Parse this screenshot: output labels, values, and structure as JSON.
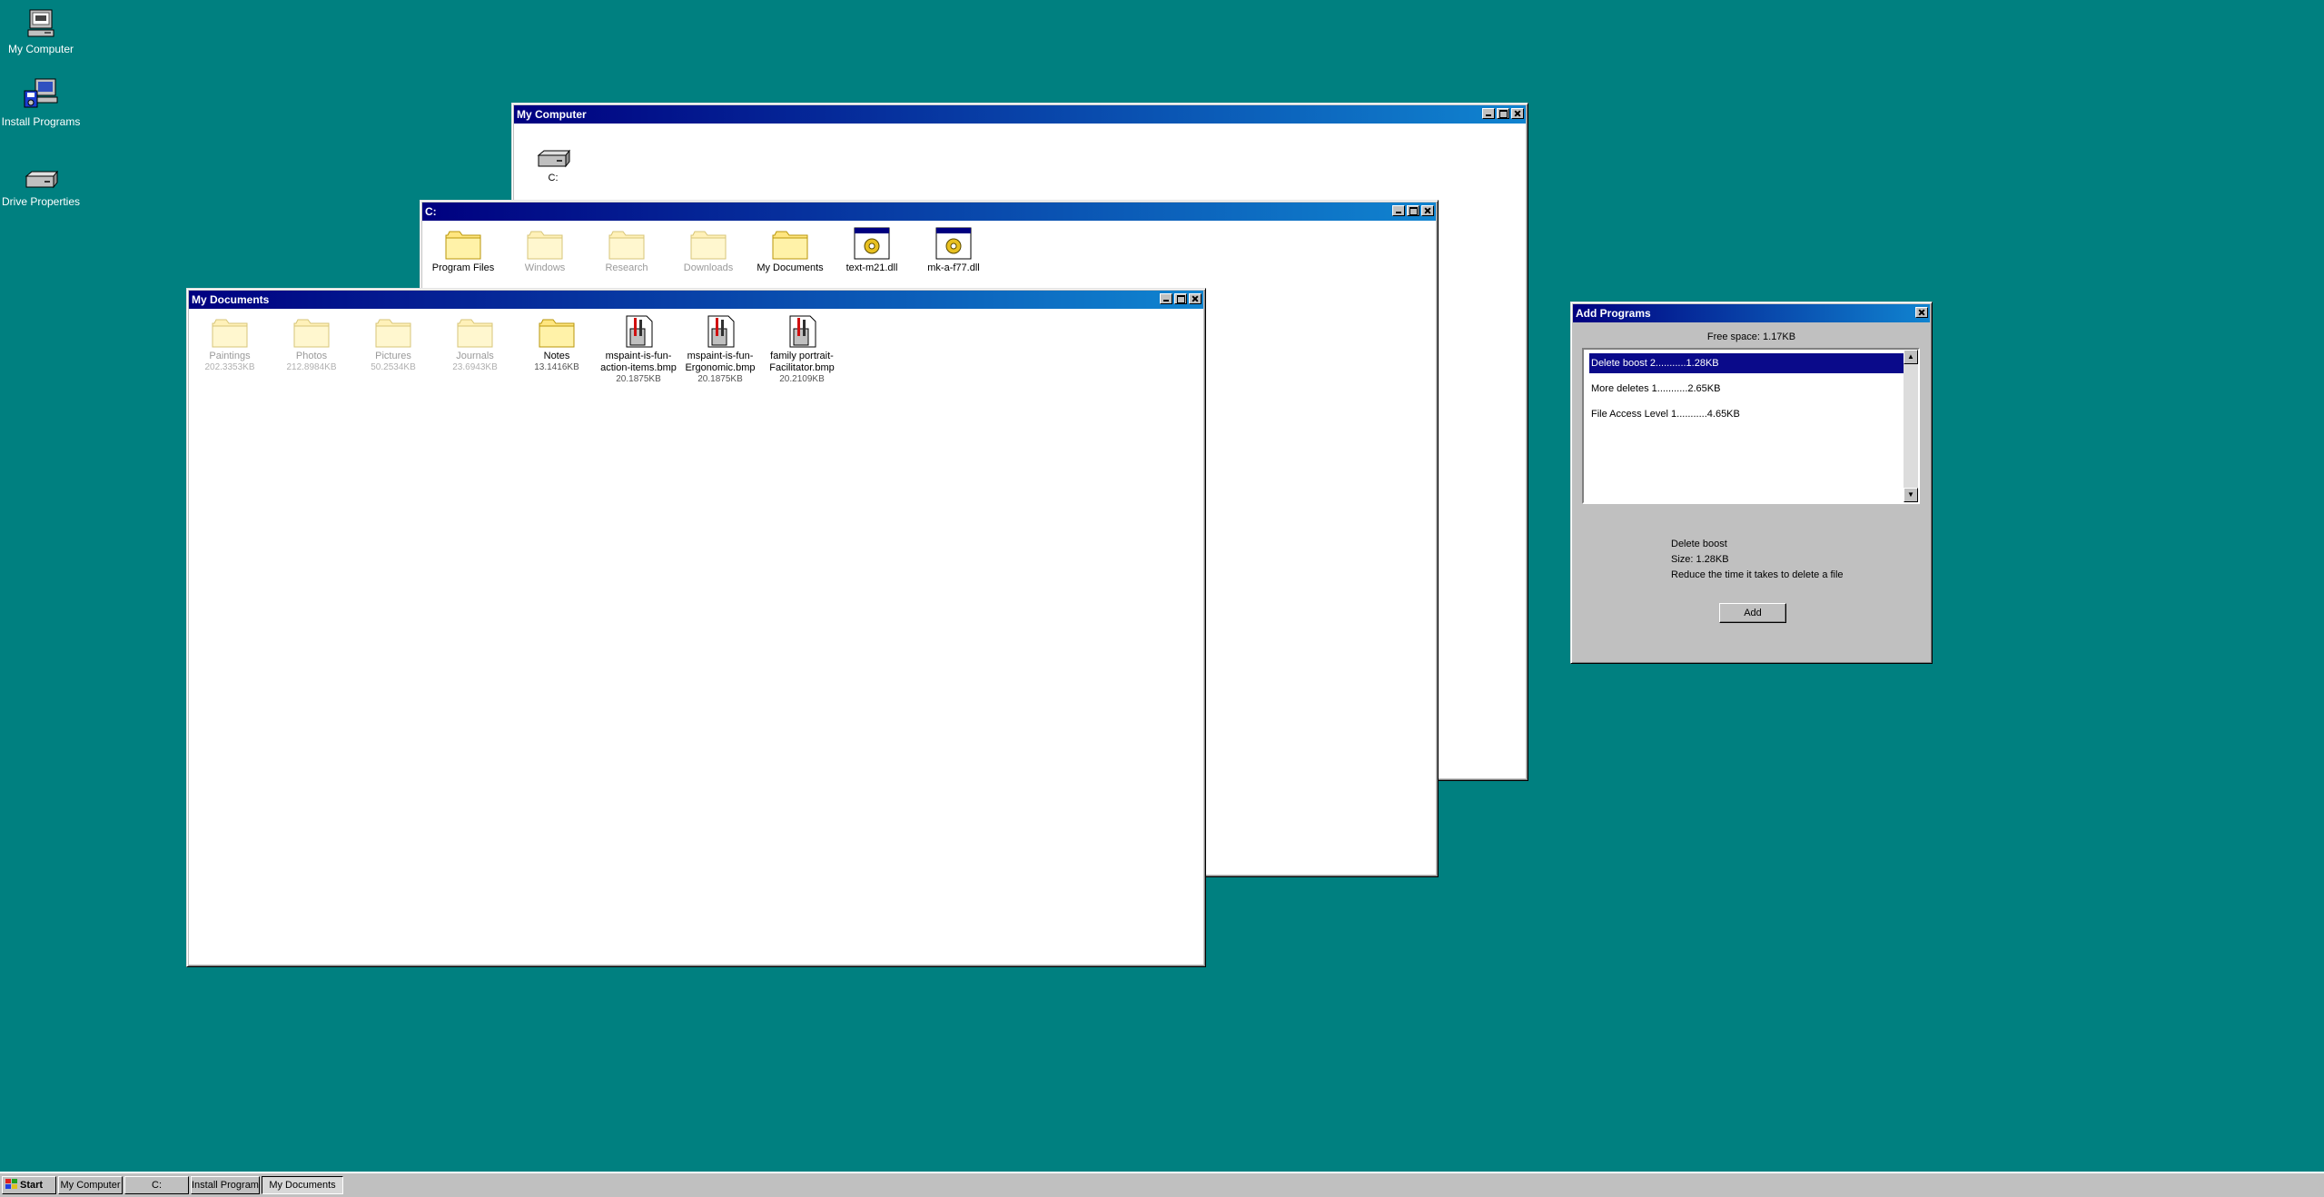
{
  "desktop": {
    "icons": [
      {
        "label": "My Computer",
        "icon": "computer-icon"
      },
      {
        "label": "Install Programs",
        "icon": "install-programs-icon"
      },
      {
        "label": "Drive Properties",
        "icon": "drive-icon"
      }
    ]
  },
  "windows": {
    "my_computer": {
      "title": "My Computer",
      "items": [
        {
          "label": "C:",
          "icon": "drive-icon"
        }
      ]
    },
    "c_drive": {
      "title": "C:",
      "items": [
        {
          "label": "Program Files",
          "icon": "folder-icon",
          "dim": false
        },
        {
          "label": "Windows",
          "icon": "folder-icon",
          "dim": true
        },
        {
          "label": "Research",
          "icon": "folder-icon",
          "dim": true
        },
        {
          "label": "Downloads",
          "icon": "folder-icon",
          "dim": true
        },
        {
          "label": "My Documents",
          "icon": "folder-icon",
          "dim": false
        },
        {
          "label": "text-m21.dll",
          "icon": "dll-icon",
          "dim": false
        },
        {
          "label": "mk-a-f77.dll",
          "icon": "dll-icon",
          "dim": false
        }
      ]
    },
    "my_documents": {
      "title": "My Documents",
      "items": [
        {
          "label": "Paintings",
          "size": "202.3353KB",
          "icon": "folder-icon",
          "dim": true
        },
        {
          "label": "Photos",
          "size": "212.8984KB",
          "icon": "folder-icon",
          "dim": true
        },
        {
          "label": "Pictures",
          "size": "50.2534KB",
          "icon": "folder-icon",
          "dim": true
        },
        {
          "label": "Journals",
          "size": "23.6943KB",
          "icon": "folder-icon",
          "dim": true
        },
        {
          "label": "Notes",
          "size": "13.1416KB",
          "icon": "folder-icon",
          "dim": false
        },
        {
          "label": "mspaint-is-fun-action-items.bmp",
          "size": "20.1875KB",
          "icon": "paint-file-icon",
          "dim": false
        },
        {
          "label": "mspaint-is-fun-Ergonomic.bmp",
          "size": "20.1875KB",
          "icon": "paint-file-icon",
          "dim": false
        },
        {
          "label": "family portrait-Facilitator.bmp",
          "size": "20.2109KB",
          "icon": "paint-file-icon",
          "dim": false
        }
      ]
    },
    "add_programs": {
      "title": "Add Programs",
      "free_space": "Free space: 1.17KB",
      "list": [
        "Delete boost 2...........1.28KB",
        "More deletes 1...........2.65KB",
        "File Access Level 1...........4.65KB"
      ],
      "selected_index": 0,
      "detail": {
        "name": "Delete boost",
        "size": "Size: 1.28KB",
        "description": "Reduce the time it takes to delete a file"
      },
      "add_button": "Add"
    }
  },
  "taskbar": {
    "start_label": "Start",
    "items": [
      "My Computer",
      "C:",
      "Install Programs",
      "My Documents"
    ],
    "active_index": 3
  },
  "colors": {
    "desktop": "#008080",
    "title_active": "#000080",
    "selection": "#0a0a8a"
  }
}
